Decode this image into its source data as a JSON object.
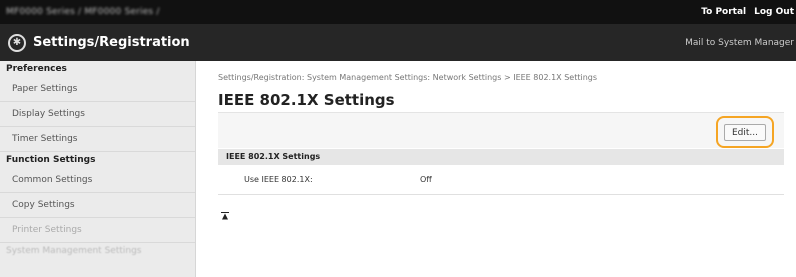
{
  "header": {
    "device_name": "MF0000 Series / MF0000 Series /",
    "links": [
      "To Portal",
      "Log Out"
    ],
    "title": "Settings/Registration",
    "mail_link": "Mail to System Manager"
  },
  "sidebar": {
    "sections": [
      {
        "heading": "Preferences",
        "items": [
          "Paper Settings",
          "Display Settings",
          "Timer Settings"
        ]
      },
      {
        "heading": "Function Settings",
        "items": [
          "Common Settings",
          "Copy Settings",
          "Printer Settings"
        ]
      },
      {
        "heading": "System Management Settings",
        "items": []
      }
    ]
  },
  "main": {
    "breadcrumb": "Settings/Registration: System Management Settings: Network Settings > IEEE 802.1X Settings",
    "title": "IEEE 802.1X Settings",
    "edit_label": "Edit...",
    "section_title": "IEEE 802.1X Settings",
    "rows": [
      {
        "label": "Use IEEE 802.1X:",
        "value": "Off"
      }
    ]
  },
  "colors": {
    "highlight": "#f5a524",
    "sidebar_bg": "#ebebeb",
    "titlebar_bg": "#262626"
  },
  "icons": {
    "app": "settings-gear-icon",
    "top_anchor": "scroll-top-icon"
  }
}
